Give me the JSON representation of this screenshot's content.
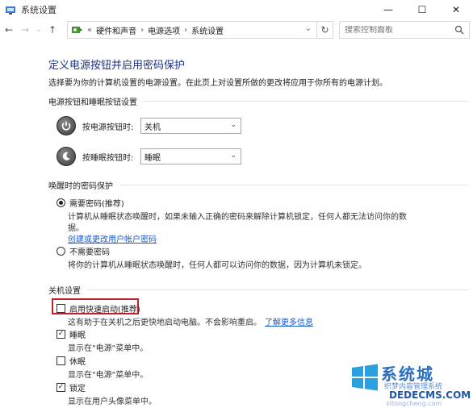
{
  "window": {
    "title": "系统设置",
    "minimize_glyph": "—",
    "maximize_glyph": "☐",
    "close_glyph": "✕"
  },
  "nav": {
    "back_glyph": "←",
    "forward_glyph": "→",
    "recent_glyph": "⌄",
    "up_glyph": "↑",
    "overflow": "«",
    "breadcrumbs": [
      "硬件和声音",
      "电源选项",
      "系统设置"
    ],
    "separator": "›",
    "refresh_glyph": "↻",
    "search_placeholder": "搜索控制面板"
  },
  "page": {
    "title": "定义电源按钮并启用密码保护",
    "description": "选择要为你的计算机设置的电源设置。在此页上对设置所做的更改将应用于你所有的电源计划。"
  },
  "power_section": {
    "heading": "电源按钮和睡眠按钮设置",
    "rows": [
      {
        "label": "按电源按钮时:",
        "value": "关机"
      },
      {
        "label": "按睡眠按钮时:",
        "value": "睡眠"
      }
    ]
  },
  "password_section": {
    "heading": "唤醒时的密码保护",
    "options": [
      {
        "label": "需要密码(推荐)",
        "selected": true,
        "desc": "计算机从睡眠状态唤醒时，如果未输入正确的密码来解除计算机锁定，任何人都无法访问你的数",
        "desc2": "据。",
        "link": "创建或更改用户帐户密码"
      },
      {
        "label": "不需要密码",
        "selected": false,
        "desc": "将你的计算机从睡眠状态唤醒时，任何人都可以访问你的数据，因为计算机未锁定。"
      }
    ]
  },
  "shutdown_section": {
    "heading": "关机设置",
    "items": [
      {
        "label": "启用快速启动(推荐)",
        "checked": false,
        "desc": "这有助于在关机之后更快地启动电脑。不会影响重启。",
        "link": "了解更多信息"
      },
      {
        "label": "睡眠",
        "checked": true,
        "desc": "显示在\"电源\"菜单中。"
      },
      {
        "label": "休眠",
        "checked": false,
        "desc": "显示在\"电源\"菜单中。"
      },
      {
        "label": "锁定",
        "checked": true,
        "desc": "显示在用户头像菜单中。"
      }
    ]
  },
  "watermark": {
    "line1": "系统城",
    "line2": "织梦内容管理系统",
    "line3": "DEDECMS.COM",
    "line4": "xitongcheng.com"
  },
  "colors": {
    "title_blue": "#1e3287",
    "link_blue": "#1a5bd1",
    "highlight_red": "#c0202a"
  }
}
